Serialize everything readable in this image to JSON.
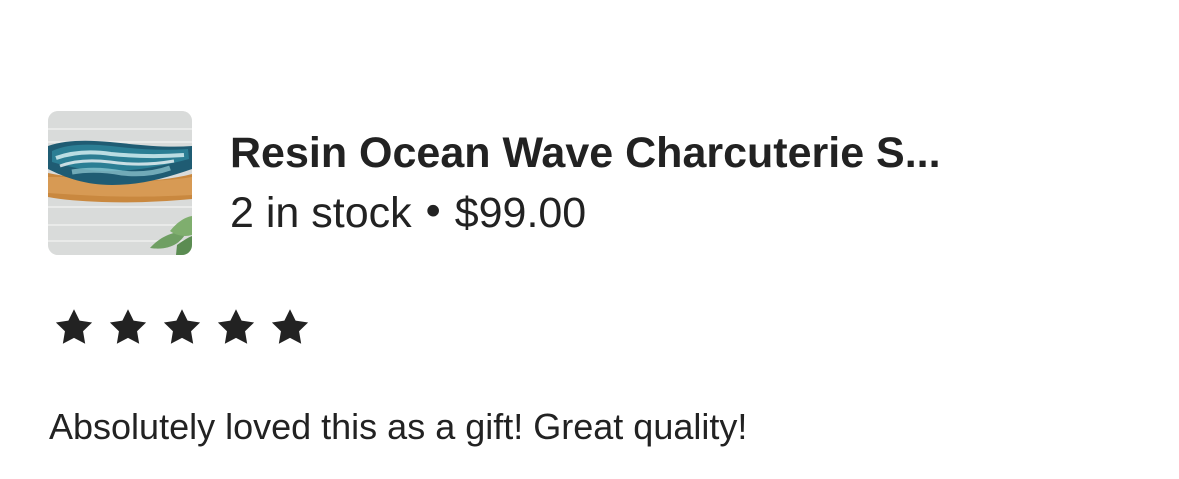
{
  "product": {
    "title": "Resin Ocean Wave Charcuterie S...",
    "stock": "2 in stock",
    "separator": "•",
    "price": "$99.00",
    "thumbnail_icon": "product-thumbnail-image"
  },
  "review": {
    "rating_value": 5,
    "rating_max": 5,
    "star_icon": "filled-star-icon",
    "text": "Absolutely loved this as a gift! Great quality!"
  },
  "colors": {
    "text": "#222222",
    "background": "#ffffff",
    "star": "#222222"
  }
}
